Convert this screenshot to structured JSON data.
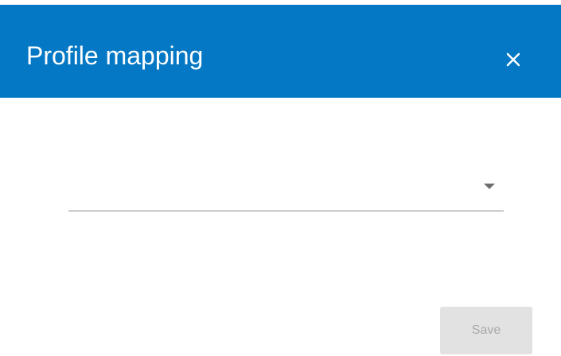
{
  "dialog": {
    "title": "Profile mapping",
    "close_icon": "close-icon",
    "header_color": "#0478c4"
  },
  "profile_select": {
    "value": "",
    "arrow_icon": "caret-down-icon"
  },
  "footer": {
    "save_label": "Save",
    "save_disabled": true
  }
}
